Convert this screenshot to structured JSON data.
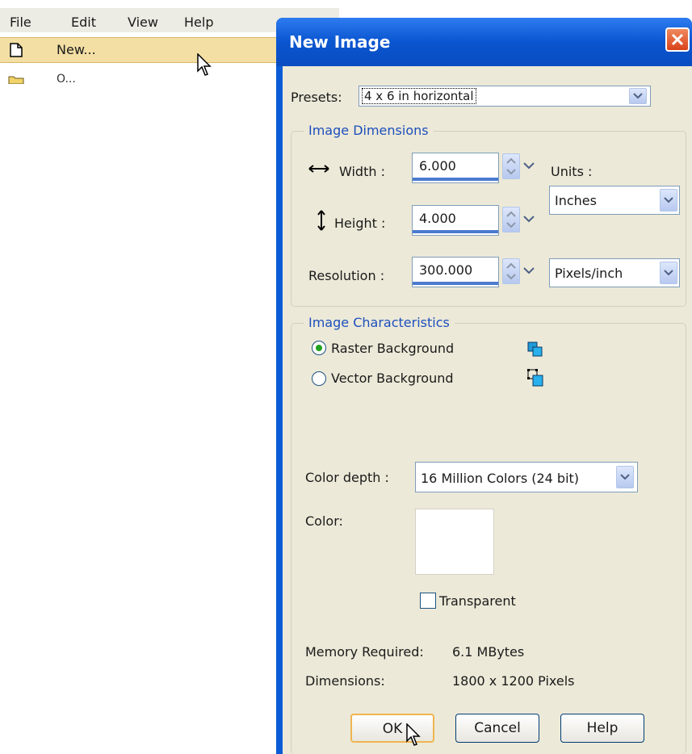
{
  "menubar": {
    "items": [
      {
        "label": "File"
      },
      {
        "label": "Edit"
      },
      {
        "label": "View"
      },
      {
        "label": "Help"
      }
    ]
  },
  "file_menu": {
    "new_label": "New...",
    "next_label": "O..."
  },
  "dialog": {
    "title": "New Image",
    "presets_label": "Presets:",
    "presets_value": "4 x 6 in horizontal",
    "image_dimensions": {
      "group_title": "Image Dimensions",
      "width_label": "Width :",
      "width_value": "6.000",
      "height_label": "Height :",
      "height_value": "4.000",
      "resolution_label": "Resolution :",
      "resolution_value": "300.000",
      "units_label": "Units :",
      "units_value": "Inches",
      "resolution_units_value": "Pixels/inch"
    },
    "image_characteristics": {
      "group_title": "Image Characteristics",
      "raster_label": "Raster Background",
      "vector_label": "Vector Background",
      "selected": "Raster Background"
    },
    "color_depth_label": "Color depth :",
    "color_depth_value": "16 Million Colors (24 bit)",
    "color_label": "Color:",
    "color_value": "#ffffff",
    "transparent_label": "Transparent",
    "transparent_checked": false,
    "memory_label": "Memory Required:",
    "memory_value": "6.1 MBytes",
    "dimensions_label": "Dimensions:",
    "dimensions_value": "1800 x 1200 Pixels",
    "buttons": {
      "ok": "OK",
      "cancel": "Cancel",
      "help": "Help"
    }
  },
  "colors": {
    "titlebar": "#0a55d0",
    "dialog_bg": "#ece9d8",
    "group_title": "#1d4fbd",
    "menu_highlight": "#f3dfa4"
  }
}
